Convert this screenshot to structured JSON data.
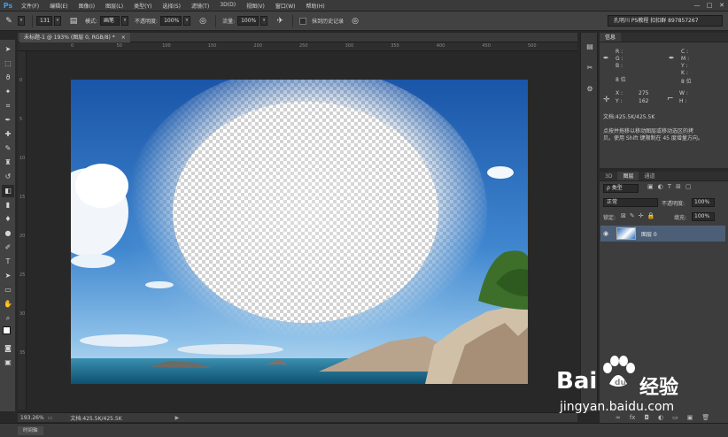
{
  "app": {
    "logo": "Ps"
  },
  "menu": [
    "文件(F)",
    "编辑(E)",
    "图像(I)",
    "图层(L)",
    "类型(Y)",
    "选择(S)",
    "滤镜(T)",
    "3D(D)",
    "视图(V)",
    "窗口(W)",
    "帮助(H)"
  ],
  "window_buttons": [
    "—",
    "□",
    "✕"
  ],
  "options": {
    "brush_size": "131",
    "mode_label": "模式:",
    "mode_value": "画笔",
    "opacity_label": "不透明度:",
    "opacity_value": "100%",
    "flow_label": "流量:",
    "flow_value": "100%",
    "history_label": "抹到历史记录",
    "workspace": "孔明川 PS教程 扣扣群 897857267"
  },
  "document": {
    "tab_title": "未标题-1 @ 193% (图层 0, RGB/8) *",
    "close": "×",
    "zoom": "193.26%",
    "doc_size": "文档:425.5K/425.5K"
  },
  "ruler_h_ticks": [
    "0",
    "50",
    "100",
    "150",
    "200",
    "250",
    "300",
    "350",
    "400",
    "450",
    "500"
  ],
  "ruler_v_ticks": [
    "0",
    "5",
    "10",
    "15",
    "20",
    "25",
    "30",
    "35"
  ],
  "info_panel": {
    "tabs": [
      "信息"
    ],
    "r": "R :",
    "g": "G :",
    "b": "B :",
    "c": "C :",
    "m": "M :",
    "y": "Y :",
    "k": "K :",
    "bits_left": "8 位",
    "bits_right": "8 位",
    "x_label": "X :",
    "x_value": "275",
    "y_label": "Y :",
    "y_value": "162",
    "w_label": "W :",
    "h_label": "H :",
    "doc": "文档:425.5K/425.5K",
    "hint_line1": "点按并拖移以移动图层或移动选区的拷",
    "hint_line2": "贝。使用 Shift 键限制在 45 度增量方向。"
  },
  "layers_panel": {
    "tabs": [
      "3D",
      "图层",
      "通道"
    ],
    "filter": "ρ 类型",
    "blend": "正常",
    "opacity_label": "不透明度:",
    "opacity_value": "100%",
    "lock_label": "锁定:",
    "fill_label": "填充:",
    "fill_value": "100%",
    "layer_name": "图层 0",
    "bottom_icons": [
      "∞",
      "fx",
      "◘",
      "◐",
      "▭",
      "▣",
      "🗑"
    ]
  },
  "bottom": {
    "timeline": "时间轴"
  },
  "watermark": {
    "brand": "Bai",
    "brand_suffix": "经验",
    "url": "jingyan.baidu.com"
  }
}
